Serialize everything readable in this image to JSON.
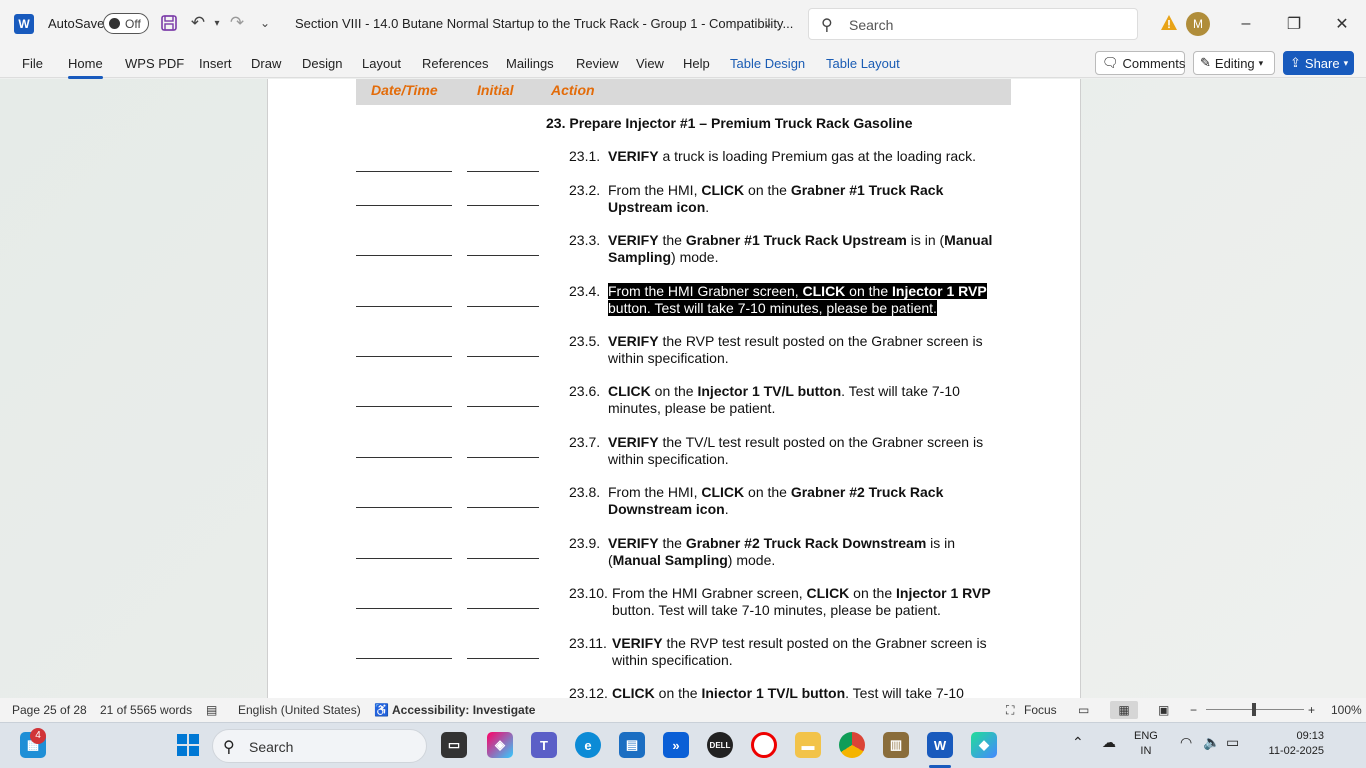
{
  "titlebar": {
    "autosave_label": "AutoSave",
    "autosave_state": "Off",
    "doc_title": "Section VIII - 14.0 Butane Normal Startup to the Truck Rack - Group 1  -  Compatibility...",
    "search_placeholder": "Search",
    "avatar_initial": "M"
  },
  "ribbon": {
    "tabs": [
      "File",
      "Home",
      "WPS PDF",
      "Insert",
      "Draw",
      "Design",
      "Layout",
      "References",
      "Mailings",
      "Review",
      "View",
      "Help",
      "Table Design",
      "Table Layout"
    ],
    "comments_label": "Comments",
    "editing_label": "Editing",
    "share_label": "Share"
  },
  "document": {
    "header_cols": [
      "Date/Time",
      "Initial",
      "Action"
    ],
    "section_title": "23. Prepare Injector #1 – Premium Truck Rack Gasoline",
    "steps": [
      {
        "num": "23.1.",
        "text": "VERIFY a truck is loading Premium gas at the loading rack."
      },
      {
        "num": "23.2.",
        "text": "From the HMI, CLICK on the Grabner #1 Truck Rack Upstream icon."
      },
      {
        "num": "23.3.",
        "text": "VERIFY the Grabner #1 Truck Rack Upstream is in (Manual Sampling) mode."
      },
      {
        "num": "23.4.",
        "text": "From the HMI Grabner screen, CLICK on the Injector 1 RVP button. Test will take 7-10 minutes, please be patient."
      },
      {
        "num": "23.5.",
        "text": "VERIFY the RVP test result posted on the Grabner screen is within specification."
      },
      {
        "num": "23.6.",
        "text": "CLICK on the Injector 1 TV/L button. Test will take 7-10 minutes, please be patient."
      },
      {
        "num": "23.7.",
        "text": "VERIFY the TV/L test result posted on the Grabner screen is within specification."
      },
      {
        "num": "23.8.",
        "text": "From the HMI, CLICK on the Grabner #2 Truck Rack Downstream icon."
      },
      {
        "num": "23.9.",
        "text": "VERIFY the Grabner #2 Truck Rack Downstream is in (Manual Sampling) mode."
      },
      {
        "num": "23.10.",
        "text": "From the HMI Grabner screen, CLICK on the Injector 1 RVP button. Test will take 7-10 minutes, please be patient."
      },
      {
        "num": "23.11.",
        "text": "VERIFY the RVP test result posted on the Grabner screen is within specification."
      },
      {
        "num": "23.12.",
        "text": "CLICK on the Injector 1 TV/L button. Test will take 7-10"
      }
    ]
  },
  "statusbar": {
    "page": "Page 25 of 28",
    "words": "21 of 5565 words",
    "language": "English (United States)",
    "accessibility": "Accessibility: Investigate",
    "focus": "Focus",
    "zoom": "100%"
  },
  "taskbar": {
    "search_placeholder": "Search",
    "badge_count": "4",
    "lang_top": "ENG",
    "lang_bottom": "IN",
    "time": "09:13",
    "date": "11-02-2025"
  },
  "colors": {
    "accent": "#185abd",
    "header_orange": "#e36c0a"
  }
}
